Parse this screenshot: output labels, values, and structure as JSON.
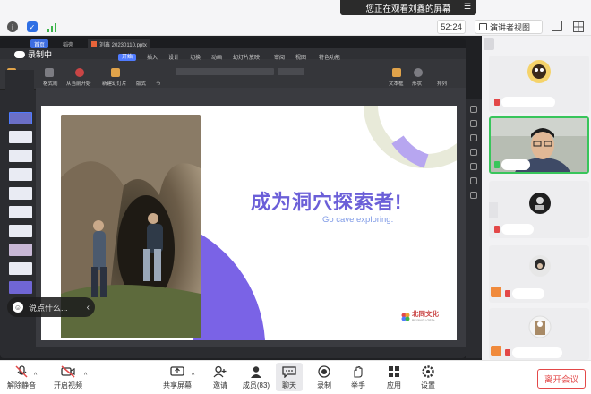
{
  "top_bar": {
    "share_banner": "您正在观看刘鑫的屏幕",
    "timer": "52:24",
    "view_mode": "演讲者视图"
  },
  "wps": {
    "tabs": [
      "首页",
      "稻壳",
      "刘鑫 20230110.pptx"
    ],
    "menu": [
      "开始",
      "插入",
      "设计",
      "切换",
      "动画",
      "幻灯片放映",
      "审阅",
      "视图",
      "特色功能"
    ],
    "recording": "录制中",
    "ribbon_labels": [
      "粘贴",
      "格式刷",
      "从当前开始",
      "新建幻灯片",
      "版式",
      "节",
      "文本框",
      "形状",
      "排列"
    ]
  },
  "slide": {
    "title": "成为洞穴探索者!",
    "subtitle": "Go cave exploring.",
    "logo": "北同文化",
    "logo_sub": "BEIJING LGBT+",
    "colors": {
      "title": "#6b5fd8",
      "accent": "#7a63e6",
      "arc": "#e8ead9"
    }
  },
  "chat_hint": {
    "placeholder": "说点什么..."
  },
  "toolbar": {
    "unmute": "解除静音",
    "video": "开启视频",
    "share": "共享屏幕",
    "invite": "邀请",
    "members": "成员(83)",
    "chat": "聊天",
    "record": "录制",
    "raise_hand": "举手",
    "apps": "应用",
    "settings": "设置",
    "leave": "离开会议"
  }
}
